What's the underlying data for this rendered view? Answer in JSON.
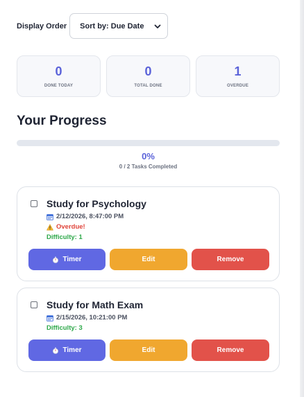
{
  "controls": {
    "display_order_label": "Display Order",
    "sort_selected": "Sort by: Due Date"
  },
  "stats": [
    {
      "value": "0",
      "label": "DONE TODAY"
    },
    {
      "value": "0",
      "label": "TOTAL DONE"
    },
    {
      "value": "1",
      "label": "OVERDUE"
    }
  ],
  "progress": {
    "title": "Your Progress",
    "percent_label": "0%",
    "fraction": 0,
    "summary": "0 / 2 Tasks Completed"
  },
  "tasks": [
    {
      "title": "Study for Psychology",
      "date": "2/12/2026, 8:47:00 PM",
      "overdue": "Overdue!",
      "difficulty": "Difficulty: 1",
      "timer_label": "Timer",
      "edit_label": "Edit",
      "remove_label": "Remove"
    },
    {
      "title": "Study for Math Exam",
      "date": "2/15/2026, 10:21:00 PM",
      "difficulty": "Difficulty: 3",
      "timer_label": "Timer",
      "edit_label": "Edit",
      "remove_label": "Remove"
    }
  ],
  "icons": {
    "calendar": "calendar-icon",
    "warning": "warning-icon",
    "timer": "stopwatch-icon",
    "dropdown": "chevron-down-icon"
  },
  "colors": {
    "accent": "#5b63d9",
    "timer": "#6068e3",
    "edit": "#f0a72f",
    "remove": "#e2524a",
    "overdue": "#e0443a",
    "difficulty": "#2ea84a"
  }
}
